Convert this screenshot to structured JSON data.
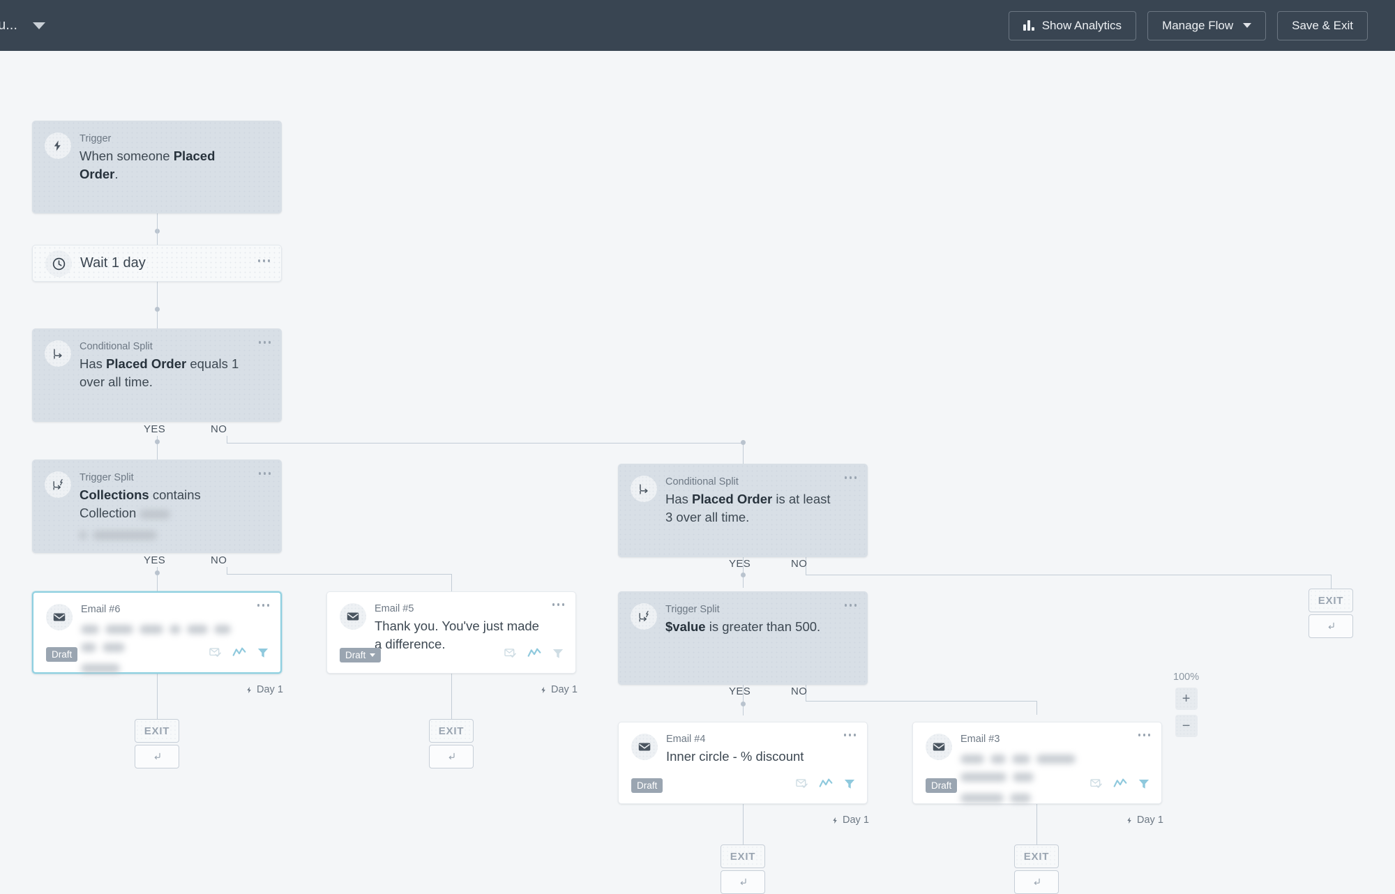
{
  "header": {
    "flow_name": "ou...",
    "dropdown_icon": "chevron-down-icon",
    "buttons": {
      "analytics": "Show Analytics",
      "analytics_icon": "bar-chart-icon",
      "manage_flow": "Manage Flow",
      "manage_flow_icon": "chevron-down-icon",
      "save_exit": "Save & Exit"
    }
  },
  "zoom_control": {
    "level": "100%",
    "zoom_in": "+",
    "zoom_out": "−"
  },
  "branch_labels": {
    "yes": "YES",
    "no": "NO"
  },
  "exit": {
    "label": "EXIT",
    "sub_icon": "return-arrow-icon"
  },
  "nodes": {
    "trigger": {
      "kicker": "Trigger",
      "icon": "lightning-bolt-icon",
      "desc_prefix": "When someone ",
      "desc_bold": "Placed Order",
      "desc_suffix": "."
    },
    "wait": {
      "title": "Wait 1 day",
      "icon": "clock-icon",
      "kebab": "more-options-icon"
    },
    "split1": {
      "kicker": "Conditional Split",
      "icon": "split-branch-icon",
      "desc_prefix": "Has ",
      "desc_bold": "Placed Order",
      "desc_suffix": " equals 1 over all time."
    },
    "trigger_split_left": {
      "kicker": "Trigger Split",
      "icon": "trigger-split-icon",
      "desc_bold": "Collections",
      "desc_mid": " contains Collection ",
      "redacted": true
    },
    "split2": {
      "kicker": "Conditional Split",
      "icon": "split-branch-icon",
      "desc_prefix": "Has ",
      "desc_bold": "Placed Order",
      "desc_suffix": " is at least 3 over all time."
    },
    "trigger_split_right": {
      "kicker": "Trigger Split",
      "icon": "trigger-split-icon",
      "desc_bold": "$value",
      "desc_suffix": " is greater than 500."
    }
  },
  "emails": {
    "email6": {
      "kicker": "Email #6",
      "subject_redacted": true,
      "status": "Draft",
      "has_status_caret": false,
      "day": "Day 1",
      "selected": true
    },
    "email5": {
      "kicker": "Email #5",
      "subject": "Thank you. You've just made a difference.",
      "status": "Draft",
      "has_status_caret": true,
      "day": "Day 1",
      "selected": false
    },
    "email4": {
      "kicker": "Email #4",
      "subject": "Inner circle - % discount",
      "status": "Draft",
      "has_status_caret": false,
      "day": "Day 1",
      "selected": false
    },
    "email3": {
      "kicker": "Email #3",
      "subject_redacted": true,
      "status": "Draft",
      "has_status_caret": false,
      "day": "Day 1",
      "selected": false
    }
  },
  "email_action_icons": [
    "envelope-check-icon",
    "analytics-wave-icon",
    "filter-funnel-icon"
  ],
  "colors": {
    "canvas_bg": "#f4f6f8",
    "topbar_bg": "#394552",
    "split_node_bg": "#d8dfe6",
    "selected_border": "#8fd0e0",
    "action_icon": "#8fc9dd",
    "connector": "#c2ccd6"
  }
}
